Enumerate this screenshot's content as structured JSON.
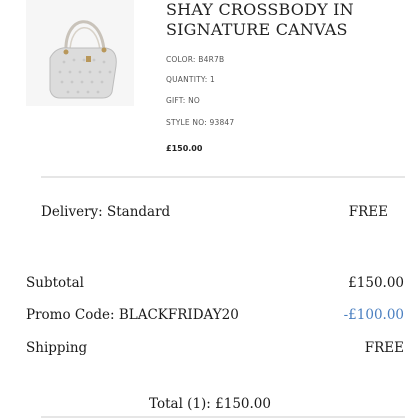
{
  "product": {
    "name_line1": "SHAY CROSSBODY IN",
    "name_line2": "SIGNATURE CANVAS",
    "color": "COLOR: B4R7B",
    "quantity": "QUANTITY: 1",
    "gift": "GIFT: NO",
    "style_no": "STYLE NO: 93847",
    "price": "£150.00",
    "image_icon": "handbag-image"
  },
  "delivery": {
    "label": "Delivery: Standard",
    "value": "FREE"
  },
  "summary": {
    "subtotal_label": "Subtotal",
    "subtotal_value": "£150.00",
    "promo_label": "Promo Code: BLACKFRIDAY20",
    "promo_value": "-£100.00",
    "shipping_label": "Shipping",
    "shipping_value": "FREE",
    "total": "Total (1): £150.00"
  },
  "colors": {
    "promo_accent": "#4a7fc0",
    "divider": "#e6e6e6"
  }
}
